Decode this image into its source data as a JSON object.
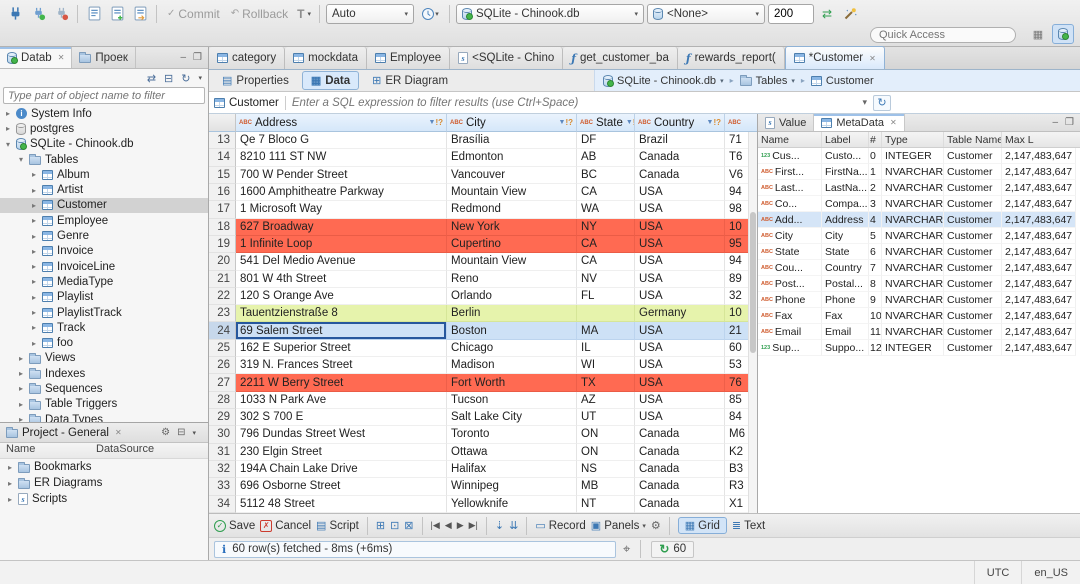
{
  "colors": {
    "accent": "#3875d7",
    "row_red": "#ff6a52",
    "row_green": "#e6f3ac",
    "row_selected": "#cde1f6",
    "header_blue": "#d5e7f9"
  },
  "icons": {
    "arrow_right": "▸",
    "arrow_down": "▾",
    "caret": "▾",
    "close": "✕",
    "funnel": "▼",
    "funnel_mark": "!?",
    "abc": "ABC",
    "num": "123",
    "check": "✓",
    "cross": "✗",
    "rollback": "↶",
    "tx": "T",
    "gear": "⚙",
    "refresh": "↻",
    "sync": "⇄",
    "collapse": "⊟",
    "info_circle": "ℹ",
    "record": "▭",
    "panels": "▣",
    "grid": "▦",
    "text_lines": "≣",
    "script": "▤",
    "add": "⊞",
    "dup": "⊡",
    "del": "⊠",
    "nav_first": "|◀",
    "nav_prev": "◀",
    "nav_next": "▶",
    "nav_last": "▶|",
    "fetch_page": "⇣",
    "fetch_all": "⇊",
    "target": "⌖",
    "min": "–",
    "max": "❐",
    "fn": "ƒ",
    "props": "▤",
    "diagram": "⊞"
  },
  "toolbar": {
    "commit_label": "Commit",
    "rollback_label": "Rollback",
    "auto_value": "Auto",
    "connection_value": "SQLite - Chinook.db",
    "schema_value": "<None>",
    "fetch_size_value": "200",
    "quick_access_placeholder": "Quick Access"
  },
  "navigator": {
    "tab_db": "Datab",
    "tab_project": "Проек",
    "filter_placeholder": "Type part of object name to filter",
    "tree": [
      {
        "label": "System Info",
        "depth": 1,
        "arrow": "r",
        "icon": "info"
      },
      {
        "label": "postgres",
        "depth": 1,
        "arrow": "r",
        "icon": "db-gray"
      },
      {
        "label": "SQLite - Chinook.db",
        "depth": 1,
        "arrow": "d",
        "icon": "db"
      },
      {
        "label": "Tables",
        "depth": 2,
        "arrow": "d",
        "icon": "folder"
      },
      {
        "label": "Album",
        "depth": 3,
        "arrow": "r",
        "icon": "table"
      },
      {
        "label": "Artist",
        "depth": 3,
        "arrow": "r",
        "icon": "table"
      },
      {
        "label": "Customer",
        "depth": 3,
        "arrow": "r",
        "icon": "table",
        "sel": true
      },
      {
        "label": "Employee",
        "depth": 3,
        "arrow": "r",
        "icon": "table"
      },
      {
        "label": "Genre",
        "depth": 3,
        "arrow": "r",
        "icon": "table"
      },
      {
        "label": "Invoice",
        "depth": 3,
        "arrow": "r",
        "icon": "table"
      },
      {
        "label": "InvoiceLine",
        "depth": 3,
        "arrow": "r",
        "icon": "table"
      },
      {
        "label": "MediaType",
        "depth": 3,
        "arrow": "r",
        "icon": "table"
      },
      {
        "label": "Playlist",
        "depth": 3,
        "arrow": "r",
        "icon": "table"
      },
      {
        "label": "PlaylistTrack",
        "depth": 3,
        "arrow": "r",
        "icon": "table"
      },
      {
        "label": "Track",
        "depth": 3,
        "arrow": "r",
        "icon": "table"
      },
      {
        "label": "foo",
        "depth": 3,
        "arrow": "r",
        "icon": "table"
      },
      {
        "label": "Views",
        "depth": 2,
        "arrow": "r",
        "icon": "folder"
      },
      {
        "label": "Indexes",
        "depth": 2,
        "arrow": "r",
        "icon": "folder"
      },
      {
        "label": "Sequences",
        "depth": 2,
        "arrow": "r",
        "icon": "folder"
      },
      {
        "label": "Table Triggers",
        "depth": 2,
        "arrow": "r",
        "icon": "folder"
      },
      {
        "label": "Data Types",
        "depth": 2,
        "arrow": "r",
        "icon": "folder"
      }
    ]
  },
  "project": {
    "title": "Project - General",
    "col_name": "Name",
    "col_datasource": "DataSource",
    "items": [
      {
        "label": "Bookmarks",
        "icon": "folder"
      },
      {
        "label": "ER Diagrams",
        "icon": "folder"
      },
      {
        "label": "Scripts",
        "icon": "script"
      }
    ]
  },
  "editor": {
    "tabs": [
      {
        "label": "category",
        "icon": "table"
      },
      {
        "label": "mockdata",
        "icon": "table"
      },
      {
        "label": "Employee",
        "icon": "table"
      },
      {
        "label": "<SQLite - Chino",
        "icon": "sql"
      },
      {
        "label": "get_customer_ba",
        "icon": "fn"
      },
      {
        "label": "rewards_report(",
        "icon": "fn"
      },
      {
        "label": "*Customer",
        "icon": "table",
        "active": true
      }
    ]
  },
  "result": {
    "subtabs": [
      {
        "label": "Properties"
      },
      {
        "label": "Data",
        "active": true
      },
      {
        "label": "ER Diagram"
      }
    ],
    "breadcrumb": [
      {
        "label": "SQLite - Chinook.db",
        "icon": "db"
      },
      {
        "label": "Tables",
        "icon": "folder"
      },
      {
        "label": "Customer",
        "icon": "table"
      }
    ],
    "filter": {
      "table": "Customer",
      "placeholder": "Enter a SQL expression to filter results (use Ctrl+Space)"
    }
  },
  "grid": {
    "columns": [
      "Address",
      "City",
      "State",
      "Country"
    ],
    "rows": [
      {
        "n": "13",
        "cells": [
          "Qe 7 Bloco G",
          "Brasília",
          "DF",
          "Brazil",
          "71"
        ],
        "hl": ""
      },
      {
        "n": "14",
        "cells": [
          "8210 111 ST NW",
          "Edm​onton",
          "AB",
          "Canada",
          "T6"
        ],
        "hl": ""
      },
      {
        "n": "15",
        "cells": [
          "700 W Pender Street",
          "Vancouver",
          "BC",
          "Canada",
          "V6"
        ],
        "hl": ""
      },
      {
        "n": "16",
        "cells": [
          "1600 Amphitheatre Parkway",
          "Mountain View",
          "CA",
          "USA",
          "94"
        ],
        "hl": ""
      },
      {
        "n": "17",
        "cells": [
          "1 Microsoft Way",
          "Redmond",
          "WA",
          "USA",
          "98"
        ],
        "hl": ""
      },
      {
        "n": "18",
        "cells": [
          "627 Broadway",
          "New York",
          "NY",
          "USA",
          "10"
        ],
        "hl": "red"
      },
      {
        "n": "19",
        "cells": [
          "1 Infinite Loop",
          "Cupertino",
          "CA",
          "USA",
          "95"
        ],
        "hl": "red"
      },
      {
        "n": "20",
        "cells": [
          "541 Del Medio Avenue",
          "Mountain View",
          "CA",
          "USA",
          "94"
        ],
        "hl": ""
      },
      {
        "n": "21",
        "cells": [
          "801 W 4th Street",
          "Reno",
          "NV",
          "USA",
          "89"
        ],
        "hl": ""
      },
      {
        "n": "22",
        "cells": [
          "120 S Orange Ave",
          "Orlando",
          "FL",
          "USA",
          "32"
        ],
        "hl": ""
      },
      {
        "n": "23",
        "cells": [
          "Tauentzienstraße 8",
          "Berlin",
          "",
          "Germany",
          "10"
        ],
        "hl": "green"
      },
      {
        "n": "24",
        "cells": [
          "69 Salem Street",
          "Boston",
          "MA",
          "USA",
          "21"
        ],
        "hl": "sel"
      },
      {
        "n": "25",
        "cells": [
          "162 E Superior Street",
          "Chicago",
          "IL",
          "USA",
          "60"
        ],
        "hl": ""
      },
      {
        "n": "26",
        "cells": [
          "319 N. Frances Street",
          "Madison",
          "WI",
          "USA",
          "53"
        ],
        "hl": ""
      },
      {
        "n": "27",
        "cells": [
          "2211 W Berry Street",
          "Fort Worth",
          "TX",
          "USA",
          "76"
        ],
        "hl": "red"
      },
      {
        "n": "28",
        "cells": [
          "1033 N Park Ave",
          "Tucson",
          "AZ",
          "USA",
          "85"
        ],
        "hl": ""
      },
      {
        "n": "29",
        "cells": [
          "302 S 700 E",
          "Salt Lake City",
          "UT",
          "USA",
          "84"
        ],
        "hl": ""
      },
      {
        "n": "30",
        "cells": [
          "796 Dundas Street West",
          "Toronto",
          "ON",
          "Canada",
          "M6"
        ],
        "hl": ""
      },
      {
        "n": "31",
        "cells": [
          "230 Elgin Street",
          "Ottawa",
          "ON",
          "Canada",
          "K2"
        ],
        "hl": ""
      },
      {
        "n": "32",
        "cells": [
          "194A Chain Lake Drive",
          "Halifax",
          "NS",
          "Canada",
          "B3"
        ],
        "hl": ""
      },
      {
        "n": "33",
        "cells": [
          "696 Osborne Street",
          "Winnipeg",
          "MB",
          "Canada",
          "R3"
        ],
        "hl": ""
      },
      {
        "n": "34",
        "cells": [
          "5112 48 Street",
          "Yellowknife",
          "NT",
          "Canada",
          "X1"
        ],
        "hl": ""
      }
    ]
  },
  "panel": {
    "tabs": [
      {
        "label": "Value"
      },
      {
        "label": "MetaData",
        "active": true
      }
    ],
    "columns": [
      "Name",
      "Label",
      "#",
      "Type",
      "Table Name",
      "Max L"
    ],
    "rows": [
      {
        "icon": "123",
        "name": "Cus...",
        "label": "Custo...",
        "ord": "0",
        "type": "INTEGER",
        "table": "Customer",
        "max": "2,147,483,647"
      },
      {
        "icon": "abc",
        "name": "First...",
        "label": "FirstNa...",
        "ord": "1",
        "type": "NVARCHAR",
        "table": "Customer",
        "max": "2,147,483,647"
      },
      {
        "icon": "abc",
        "name": "Last...",
        "label": "LastNa...",
        "ord": "2",
        "type": "NVARCHAR",
        "table": "Customer",
        "max": "2,147,483,647"
      },
      {
        "icon": "abc",
        "name": "Co...",
        "label": "Compa...",
        "ord": "3",
        "type": "NVARCHAR",
        "table": "Customer",
        "max": "2,147,483,647"
      },
      {
        "icon": "abc",
        "name": "Add...",
        "label": "Address",
        "ord": "4",
        "type": "NVARCHAR",
        "table": "Customer",
        "max": "2,147,483,647",
        "selected": true
      },
      {
        "icon": "abc",
        "name": "City",
        "label": "City",
        "ord": "5",
        "type": "NVARCHAR",
        "table": "Customer",
        "max": "2,147,483,647"
      },
      {
        "icon": "abc",
        "name": "State",
        "label": "State",
        "ord": "6",
        "type": "NVARCHAR",
        "table": "Customer",
        "max": "2,147,483,647"
      },
      {
        "icon": "abc",
        "name": "Cou...",
        "label": "Country",
        "ord": "7",
        "type": "NVARCHAR",
        "table": "Customer",
        "max": "2,147,483,647"
      },
      {
        "icon": "abc",
        "name": "Post...",
        "label": "Postal...",
        "ord": "8",
        "type": "NVARCHAR",
        "table": "Customer",
        "max": "2,147,483,647"
      },
      {
        "icon": "abc",
        "name": "Phone",
        "label": "Phone",
        "ord": "9",
        "type": "NVARCHAR",
        "table": "Customer",
        "max": "2,147,483,647"
      },
      {
        "icon": "abc",
        "name": "Fax",
        "label": "Fax",
        "ord": "10",
        "type": "NVARCHAR",
        "table": "Customer",
        "max": "2,147,483,647"
      },
      {
        "icon": "abc",
        "name": "Email",
        "label": "Email",
        "ord": "11",
        "type": "NVARCHAR",
        "table": "Customer",
        "max": "2,147,483,647"
      },
      {
        "icon": "123",
        "name": "Sup...",
        "label": "Suppo...",
        "ord": "12",
        "type": "INTEGER",
        "table": "Customer",
        "max": "2,147,483,647"
      }
    ]
  },
  "bottombar": {
    "save": "Save",
    "cancel": "Cancel",
    "script": "Script",
    "record": "Record",
    "panels": "Panels",
    "grid": "Grid",
    "text": "Text"
  },
  "status": {
    "message": "60 row(s) fetched - 8ms (+6ms)",
    "refresh_count": "60"
  },
  "statusbar": {
    "tz": "UTC",
    "locale": "en_US"
  }
}
